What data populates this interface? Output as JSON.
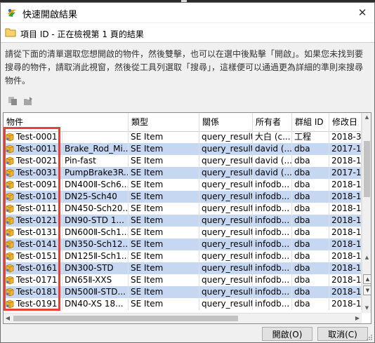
{
  "window": {
    "title": "快速開啟結果",
    "close_symbol": "✕"
  },
  "header": {
    "text": "項目 ID - 正在檢視第 1 頁的結果"
  },
  "instructions": "請從下面的清單選取您想開啟的物件，然後雙擊，也可以在選中後點擊「開啟」。如果您未找到要搜尋的物件，請取消此視窗，然後從工具列選取「搜尋」，這樣便可以通過更為詳細的準則來搜尋物件。",
  "toolbar": {
    "icons": [
      "copy-icon",
      "open-folder-icon"
    ]
  },
  "grid": {
    "columns": [
      "物件",
      "類型",
      "關係",
      "所有者",
      "群組 ID",
      "修改日"
    ],
    "rows": [
      {
        "id": "Test-0001",
        "name": "",
        "type": "SE Item",
        "rel": "query_results",
        "owner": "大白 (c...",
        "group": "工程",
        "date": "2018-3",
        "sel": false
      },
      {
        "id": "Test-0011",
        "name": "Brake_Rod_Mi...",
        "type": "SE Item",
        "rel": "query_results",
        "owner": "david (...",
        "group": "dba",
        "date": "2017-1",
        "sel": true
      },
      {
        "id": "Test-0021",
        "name": "Pin-fast",
        "type": "SE Item",
        "rel": "query_results",
        "owner": "david (...",
        "group": "dba",
        "date": "2018-1",
        "sel": false
      },
      {
        "id": "Test-0031",
        "name": "PumpBrake3R...",
        "type": "SE Item",
        "rel": "query_results",
        "owner": "david (...",
        "group": "dba",
        "date": "2017-1",
        "sel": true
      },
      {
        "id": "Test-0091",
        "name": "DN400Ⅱ-Sch6...",
        "type": "SE Item",
        "rel": "query_results",
        "owner": "infodb...",
        "group": "dba",
        "date": "2018-1",
        "sel": false
      },
      {
        "id": "Test-0101",
        "name": "DN25-Sch40",
        "type": "SE Item",
        "rel": "query_results",
        "owner": "infodb...",
        "group": "dba",
        "date": "2018-1",
        "sel": true
      },
      {
        "id": "Test-0111",
        "name": "DN450-Sch20...",
        "type": "SE Item",
        "rel": "query_results",
        "owner": "infodb...",
        "group": "dba",
        "date": "2018-1",
        "sel": false
      },
      {
        "id": "Test-0121",
        "name": "DN90-STD    1...",
        "type": "SE Item",
        "rel": "query_results",
        "owner": "infodb...",
        "group": "dba",
        "date": "2018-1",
        "sel": true
      },
      {
        "id": "Test-0131",
        "name": "DN600Ⅱ-Sch1...",
        "type": "SE Item",
        "rel": "query_results",
        "owner": "infodb...",
        "group": "dba",
        "date": "2018-1",
        "sel": false
      },
      {
        "id": "Test-0141",
        "name": "DN350-Sch12...",
        "type": "SE Item",
        "rel": "query_results",
        "owner": "infodb...",
        "group": "dba",
        "date": "2018-1",
        "sel": true
      },
      {
        "id": "Test-0151",
        "name": "DN125Ⅱ-Sch1...",
        "type": "SE Item",
        "rel": "query_results",
        "owner": "infodb...",
        "group": "dba",
        "date": "2018-1",
        "sel": false
      },
      {
        "id": "Test-0161",
        "name": "DN300-STD",
        "type": "SE Item",
        "rel": "query_results",
        "owner": "infodb...",
        "group": "dba",
        "date": "2018-1",
        "sel": true
      },
      {
        "id": "Test-0171",
        "name": "DN65Ⅱ-XXS",
        "type": "SE Item",
        "rel": "query_results",
        "owner": "infodb...",
        "group": "dba",
        "date": "2018-1",
        "sel": false
      },
      {
        "id": "Test-0181",
        "name": "DN500Ⅱ-STD...",
        "type": "SE Item",
        "rel": "query_results",
        "owner": "infodb...",
        "group": "dba",
        "date": "2018-1",
        "sel": true
      },
      {
        "id": "Test-0191",
        "name": "DN40-XS    18...",
        "type": "SE Item",
        "rel": "query_results",
        "owner": "infodb...",
        "group": "dba",
        "date": "2018-1",
        "sel": false
      }
    ]
  },
  "scrollbars": {
    "up": "▲",
    "down": "▼",
    "left": "◀",
    "right": "▶",
    "side_top": "▲",
    "side_bottom": "▼"
  },
  "buttons": {
    "open": "開啟(O)",
    "cancel": "取消(C)"
  },
  "colors": {
    "selected_row": "#c6d7f2",
    "highlight_box": "#e8413a"
  }
}
